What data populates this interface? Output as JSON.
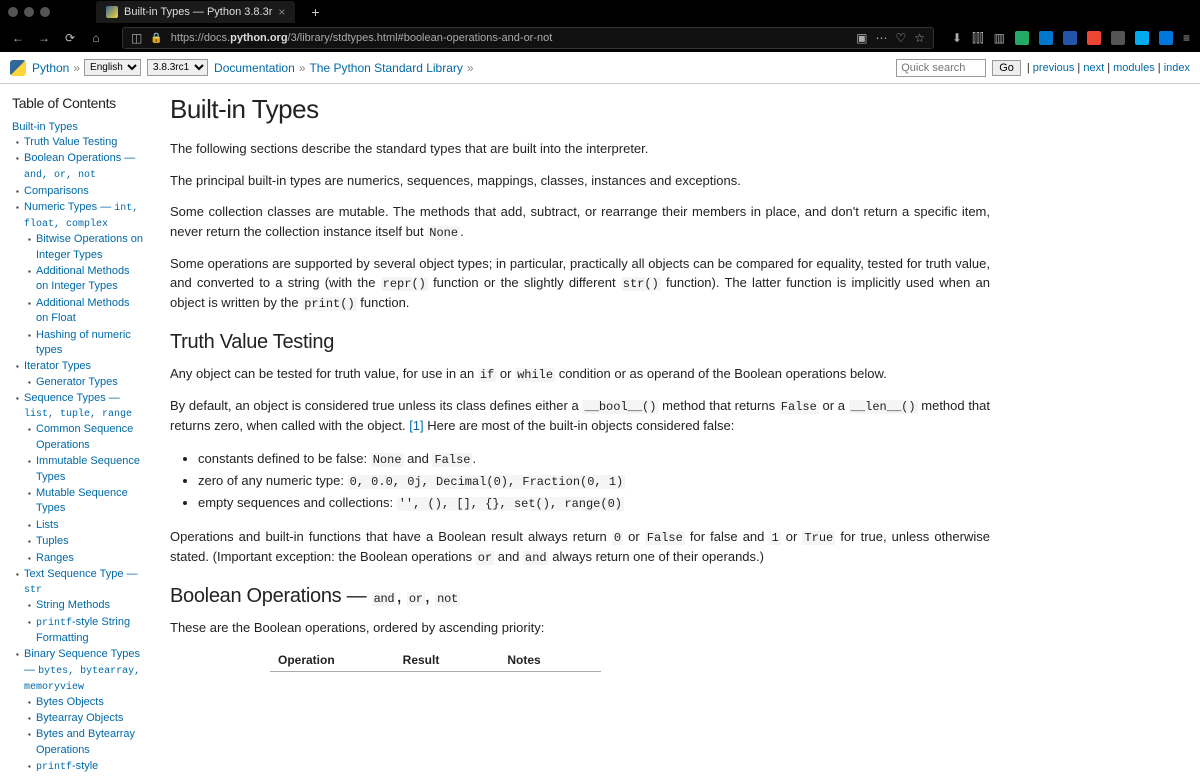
{
  "browser": {
    "tab_title": "Built-in Types — Python 3.8.3r",
    "url_prefix": "https://docs.",
    "url_bold": "python.org",
    "url_suffix": "/3/library/stdtypes.html#boolean-operations-and-or-not"
  },
  "relbar": {
    "python": "Python",
    "lang": "English",
    "version": "3.8.3rc1",
    "crumb1": "Documentation",
    "crumb2": "The Python Standard Library",
    "search_placeholder": "Quick search",
    "go": "Go",
    "nav_prev": "previous",
    "nav_next": "next",
    "nav_modules": "modules",
    "nav_index": "index"
  },
  "toc": {
    "heading": "Table of Contents",
    "root": "Built-in Types",
    "items": [
      "Truth Value Testing",
      "Boolean Operations — and, or, not",
      "Comparisons",
      "Numeric Types — int, float, complex",
      "Bitwise Operations on Integer Types",
      "Additional Methods on Integer Types",
      "Additional Methods on Float",
      "Hashing of numeric types",
      "Iterator Types",
      "Generator Types",
      "Sequence Types — list, tuple, range",
      "Common Sequence Operations",
      "Immutable Sequence Types",
      "Mutable Sequence Types",
      "Lists",
      "Tuples",
      "Ranges",
      "Text Sequence Type — str",
      "String Methods",
      "printf-style String Formatting",
      "Binary Sequence Types — bytes, bytearray, memoryview",
      "Bytes Objects",
      "Bytearray Objects",
      "Bytes and Bytearray Operations",
      "printf-style"
    ]
  },
  "doc": {
    "h1": "Built-in Types",
    "p1": "The following sections describe the standard types that are built into the interpreter.",
    "p2": "The principal built-in types are numerics, sequences, mappings, classes, instances and exceptions.",
    "p3a": "Some collection classes are mutable. The methods that add, subtract, or rearrange their members in place, and don't return a specific item, never return the collection instance itself but ",
    "p3b": "None",
    "p3c": ".",
    "p4a": "Some operations are supported by several object types; in particular, practically all objects can be compared for equality, tested for truth value, and converted to a string (with the ",
    "p4b": "repr()",
    "p4c": " function or the slightly different ",
    "p4d": "str()",
    "p4e": " function). The latter function is implicitly used when an object is written by the ",
    "p4f": "print()",
    "p4g": " function.",
    "h2a": "Truth Value Testing",
    "tv1a": "Any object can be tested for truth value, for use in an ",
    "tv1b": "if",
    "tv1c": " or ",
    "tv1d": "while",
    "tv1e": " condition or as operand of the Boolean operations below.",
    "tv2a": "By default, an object is considered true unless its class defines either a ",
    "tv2b": "__bool__()",
    "tv2c": " method that returns ",
    "tv2d": "False",
    "tv2e": " or a ",
    "tv2f": "__len__()",
    "tv2g": " method that returns zero, when called with the object. ",
    "tv2h": "[1]",
    "tv2i": " Here are most of the built-in objects considered false:",
    "f1a": "constants defined to be false: ",
    "f1b": "None",
    "f1c": " and ",
    "f1d": "False",
    "f1e": ".",
    "f2a": "zero of any numeric type: ",
    "f2b": "0, 0.0, 0j, Decimal(0), Fraction(0, 1)",
    "f3a": "empty sequences and collections: ",
    "f3b": "'', (), [], {}, set(), range(0)",
    "tv3a": "Operations and built-in functions that have a Boolean result always return ",
    "tv3b": "0",
    "tv3c": " or ",
    "tv3d": "False",
    "tv3e": " for false and ",
    "tv3f": "1",
    "tv3g": " or ",
    "tv3h": "True",
    "tv3i": " for true, unless otherwise stated. (Important exception: the Boolean operations ",
    "tv3j": "or",
    "tv3k": " and ",
    "tv3l": "and",
    "tv3m": " always return one of their operands.)",
    "h2b_a": "Boolean Operations — ",
    "h2b_b": "and",
    "h2b_c": ", ",
    "h2b_d": "or",
    "h2b_e": ", ",
    "h2b_f": "not",
    "bo1": "These are the Boolean operations, ordered by ascending priority:",
    "th1": "Operation",
    "th2": "Result",
    "th3": "Notes"
  }
}
